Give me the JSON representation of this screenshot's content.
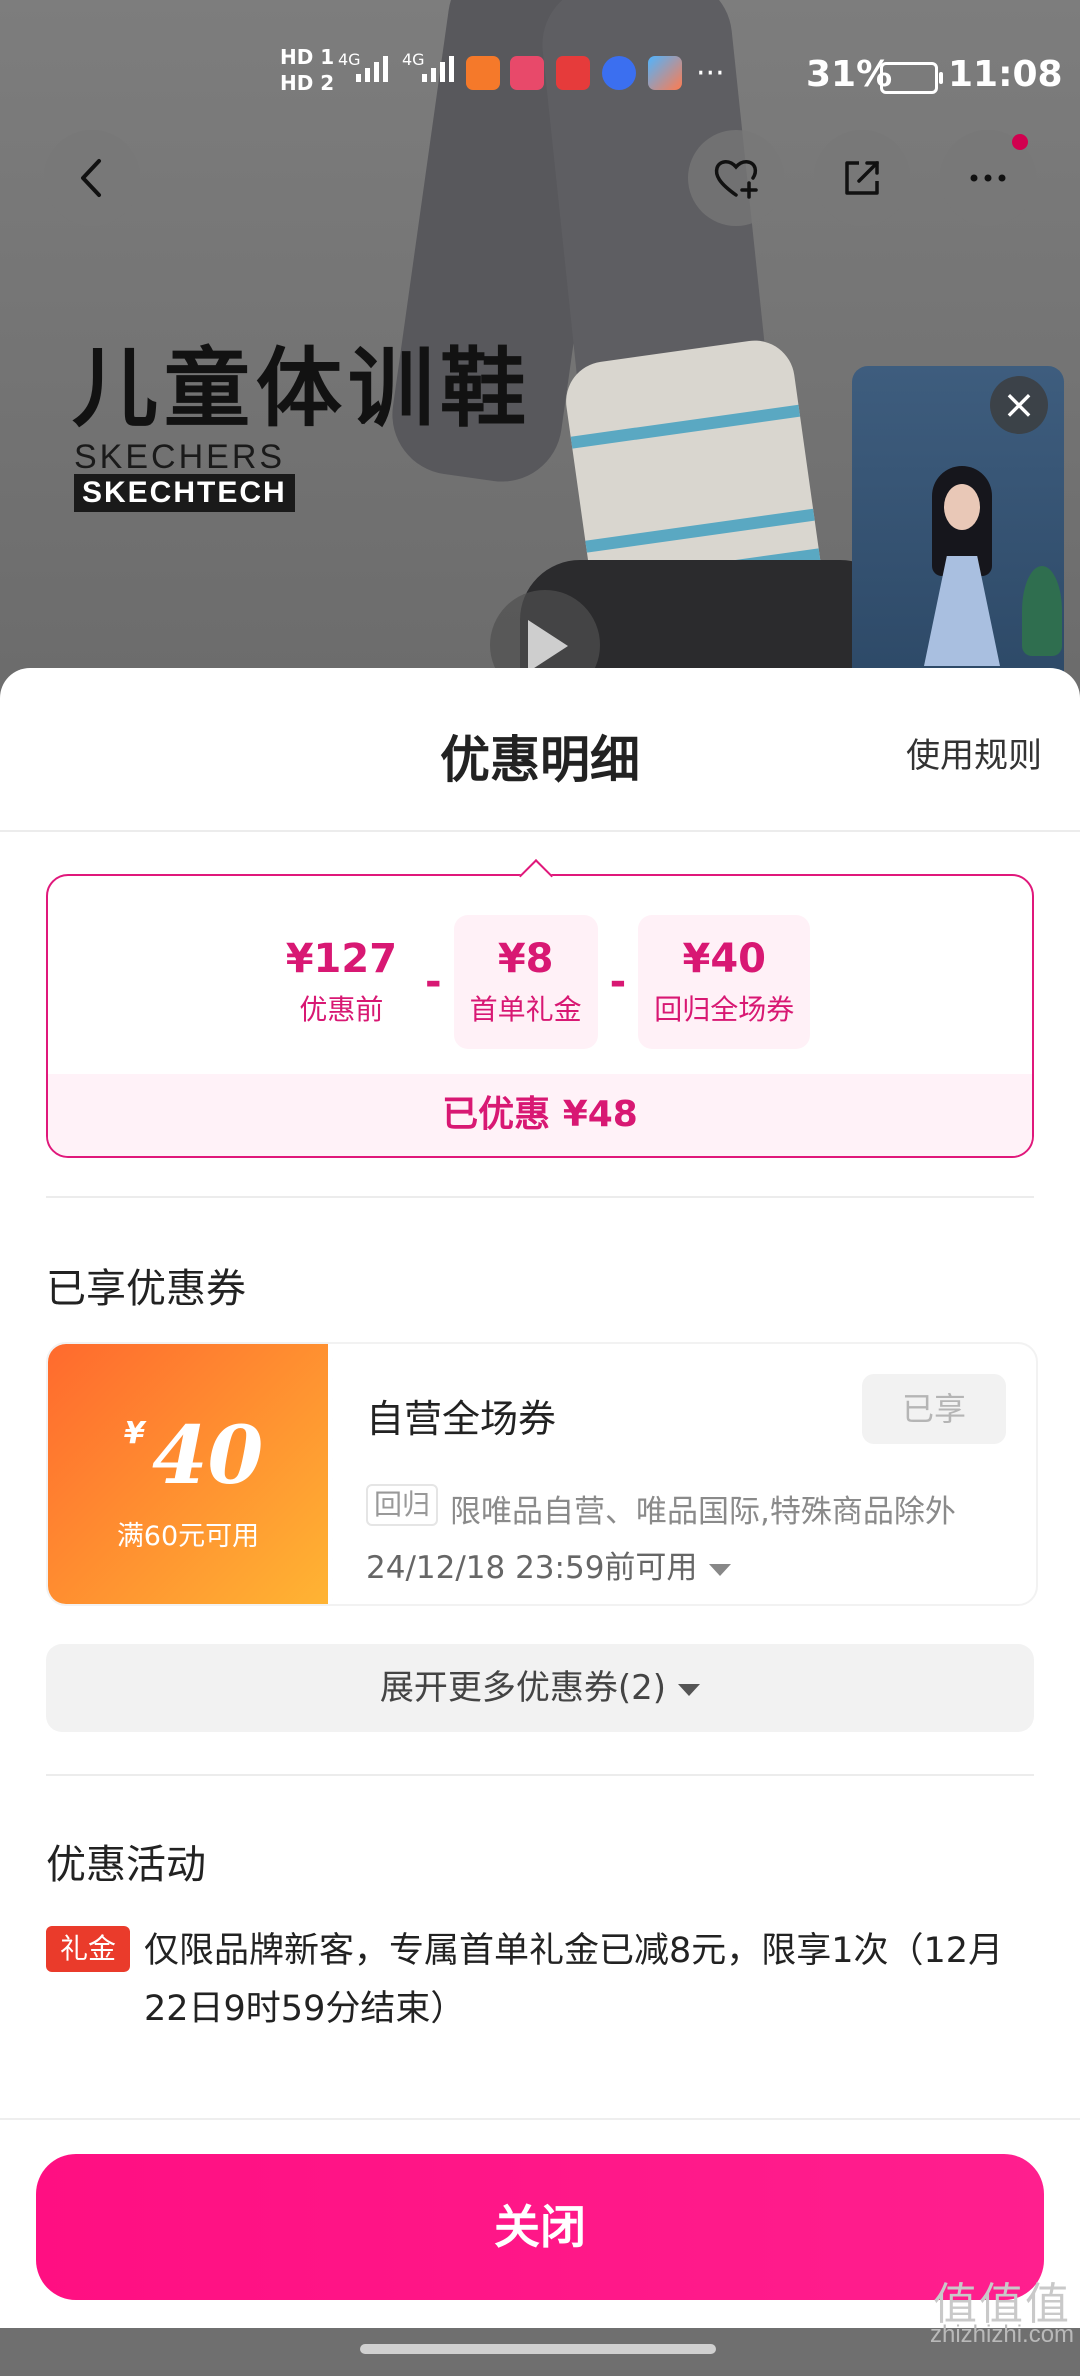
{
  "status_bar": {
    "hd1": "HD 1",
    "hd2": "HD 2",
    "signal1": "4G",
    "signal2": "4G",
    "overflow": "···",
    "battery": "31%",
    "time": "11:08"
  },
  "product_banner": {
    "title": "儿童体训鞋",
    "brand_line1": "SKECHERS",
    "brand_line2": "SKECHTECH"
  },
  "sheet": {
    "title": "优惠明细",
    "rules_link": "使用规则",
    "calc": {
      "items": [
        {
          "amount": "¥127",
          "label": "优惠前"
        },
        {
          "amount": "¥8",
          "label": "首单礼金"
        },
        {
          "amount": "¥40",
          "label": "回归全场券"
        }
      ],
      "operator": "-",
      "total": "已优惠 ¥48"
    },
    "coupons_section_title": "已享优惠券",
    "coupon": {
      "currency": "¥",
      "amount": "40",
      "condition": "满60元可用",
      "name": "自营全场券",
      "status": "已享",
      "tag": "回归",
      "description": "限唯品自营、唯品国际,特殊商品除外",
      "expiry": "24/12/18 23:59前可用"
    },
    "expand_more": "展开更多优惠券(2)",
    "activities_section_title": "优惠活动",
    "activity": {
      "tag": "礼金",
      "text": "仅限品牌新客，专属首单礼金已减8元，限享1次（12月22日9时59分结束）"
    },
    "close_button": "关闭"
  },
  "watermark": {
    "big": "值值值",
    "small": "zhizhizhi.com"
  },
  "colors": {
    "accent": "#e0187b",
    "button": "#ff1488",
    "coupon_gradient_start": "#ff6a2e",
    "coupon_gradient_end": "#ffb433",
    "gift_tag": "#ea3b2b"
  },
  "icons": [
    "back-icon",
    "favorite-add-icon",
    "share-icon",
    "more-icon",
    "close-icon",
    "play-icon",
    "chevron-down-icon"
  ]
}
